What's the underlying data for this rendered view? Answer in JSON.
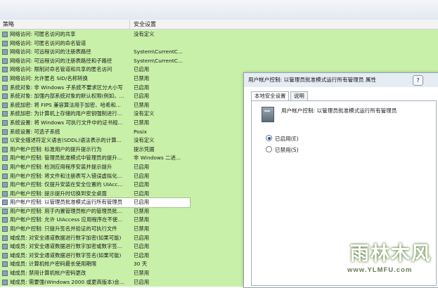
{
  "columns": {
    "policy": "策略",
    "setting": "安全设置"
  },
  "rows": [
    {
      "name": "网络访问: 可匿名访问的共享",
      "value": "没有定义"
    },
    {
      "name": "网络访问: 可匿名访问的命名管道",
      "value": ""
    },
    {
      "name": "网络访问: 可远程访问的注册表路径",
      "value": "System\\CurrentC..."
    },
    {
      "name": "网络访问: 可远程访问的注册表路径和子路径",
      "value": "System\\CurrentC..."
    },
    {
      "name": "网络访问: 限制对命名管道和共享的匿名访问",
      "value": "已启用"
    },
    {
      "name": "网络访问: 允许匿名 SID/名称转换",
      "value": "已禁用"
    },
    {
      "name": "系统对象: 非 Windows 子系统不要求区分大小写",
      "value": "已启用"
    },
    {
      "name": "系统对象: 加强内部系统对象的默认权限(例如，...",
      "value": "已启用"
    },
    {
      "name": "系统加密: 将 FIPS 兼容算法用于加密、哈希和...",
      "value": "已禁用"
    },
    {
      "name": "系统加密: 为计算机上存储的用户密钥强制进行...",
      "value": "没有定义"
    },
    {
      "name": "系统设置: 将 Windows 可执行文件中的证书规...",
      "value": "已禁用"
    },
    {
      "name": "系统设置: 可选子系统",
      "value": "Posix"
    },
    {
      "name": "以安全描述符定义语言(SDDL)语法表示的计算...",
      "value": "没有定义"
    },
    {
      "name": "用户帐户控制: 标准用户的提升提示行为",
      "value": "提示凭据"
    },
    {
      "name": "用户帐户控制: 管理员批准模式中管理员的提升...",
      "value": "非 Windows 二进..."
    },
    {
      "name": "用户帐户控制: 检测应用程序安装并提示提升",
      "value": "已启用"
    },
    {
      "name": "用户帐户控制: 将文件和注册表写入错误虚拟化...",
      "value": "已启用"
    },
    {
      "name": "用户帐户控制: 仅提升安装在安全位置的 UIAcc...",
      "value": "已启用"
    },
    {
      "name": "用户帐户控制: 提示提升时切换到安全桌面",
      "value": "已启用"
    },
    {
      "name": "用户帐户控制: 以管理员批准模式运行所有管理员",
      "value": "已启用",
      "selected": true
    },
    {
      "name": "用户帐户控制: 用于内置管理员帐户的管理员批...",
      "value": "已禁用"
    },
    {
      "name": "用户帐户控制: 允许 UIAccess 应用程序在不使...",
      "value": "已禁用"
    },
    {
      "name": "用户帐户控制: 只提升签名并验证的可执行文件",
      "value": "已禁用"
    },
    {
      "name": "域成员: 对安全通道数据进行数字加密(如果可能)",
      "value": "已启用"
    },
    {
      "name": "域成员: 对安全通道数据进行数字加密或数字签...",
      "value": "已启用"
    },
    {
      "name": "域成员: 对安全通道数据进行数字签名(如果可能)",
      "value": "已启用"
    },
    {
      "name": "域成员: 计算机帐户密码最长使用期限",
      "value": "30 天"
    },
    {
      "name": "域成员: 禁用计算机帐户密码更改",
      "value": "已禁用"
    },
    {
      "name": "域成员: 需要强(Windows 2000 或更高版本)会...",
      "value": "已启用"
    }
  ],
  "dialog": {
    "title": "用户帐户控制: 以管理员批准模式运行所有管理员 属性",
    "help": "?",
    "tabs": [
      "本地安全设置",
      "说明"
    ],
    "policy_name": "用户帐户控制: 以管理员批准模式运行所有管理员",
    "options": [
      {
        "label": "已启用(E)",
        "checked": true
      },
      {
        "label": "已禁用(S)",
        "checked": false
      }
    ]
  },
  "watermark": {
    "logo": "雨林木风",
    "url": "www.YLMFU.com"
  },
  "colors": {
    "list_bg": "#c8f0a8",
    "selected_row": "#ffffff"
  }
}
